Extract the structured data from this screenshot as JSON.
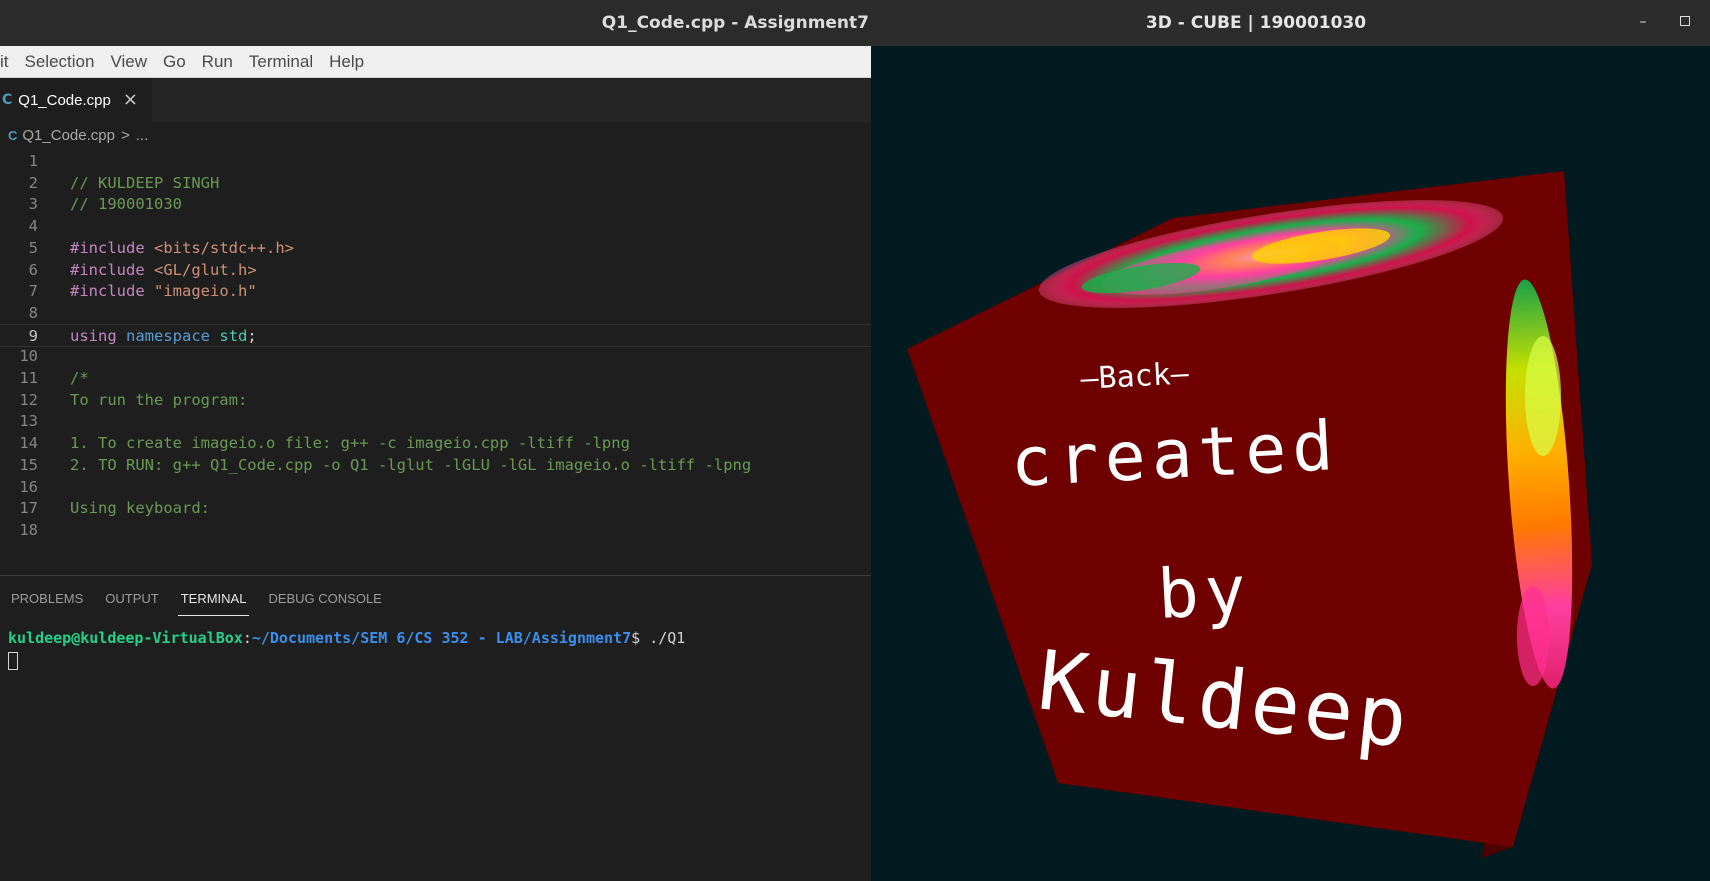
{
  "vscode": {
    "window_title": "Q1_Code.cpp - Assignment7",
    "menu": [
      "it",
      "Selection",
      "View",
      "Go",
      "Run",
      "Terminal",
      "Help"
    ],
    "tab": {
      "label": "Q1_Code.cpp",
      "icon": "cpp-file-icon",
      "close": "×"
    },
    "breadcrumb": {
      "file": "Q1_Code.cpp",
      "separator": ">",
      "rest": "..."
    },
    "code": [
      {
        "n": "1",
        "text": ""
      },
      {
        "n": "2",
        "text": "// KULDEEP SINGH"
      },
      {
        "n": "3",
        "text": "// 190001030"
      },
      {
        "n": "4",
        "text": ""
      },
      {
        "n": "5",
        "directive": "#include",
        "arg": "<bits/stdc++.h>"
      },
      {
        "n": "6",
        "directive": "#include",
        "arg": "<GL/glut.h>"
      },
      {
        "n": "7",
        "directive": "#include",
        "arg": "\"imageio.h\""
      },
      {
        "n": "8",
        "text": ""
      },
      {
        "n": "9",
        "kw1": "using",
        "kw2": "namespace",
        "ident": "std",
        "punct": ";"
      },
      {
        "n": "10",
        "text": ""
      },
      {
        "n": "11",
        "text": "/*"
      },
      {
        "n": "12",
        "text": "To run the program:"
      },
      {
        "n": "13",
        "text": ""
      },
      {
        "n": "14",
        "text": "1. To create imageio.o file: g++ -c imageio.cpp -ltiff -lpng"
      },
      {
        "n": "15",
        "text": "2. TO RUN: g++ Q1_Code.cpp -o Q1 -lglut -lGLU -lGL imageio.o -ltiff -lpng"
      },
      {
        "n": "16",
        "text": ""
      },
      {
        "n": "17",
        "text": "Using keyboard:"
      },
      {
        "n": "18",
        "text": ""
      }
    ],
    "panel": {
      "tabs": [
        "PROBLEMS",
        "OUTPUT",
        "TERMINAL",
        "DEBUG CONSOLE"
      ],
      "active_tab": "TERMINAL",
      "terminal": {
        "user": "kuldeep@kuldeep-VirtualBox",
        "colon": ":",
        "path": "~/Documents/SEM 6/CS 352 - LAB/Assignment7",
        "prompt": "$ ",
        "command": "./Q1"
      }
    }
  },
  "cube_window": {
    "title": "3D - CUBE | 190001030",
    "minimize": "–",
    "face_texts": {
      "label": "—Back—",
      "line1": "created",
      "line2": "by",
      "line3": "Kuldeep"
    },
    "colors": {
      "background": "#001a20",
      "front_face": "#6e0000",
      "right_face": "#4d0000",
      "top_face": "#5a0000"
    }
  }
}
